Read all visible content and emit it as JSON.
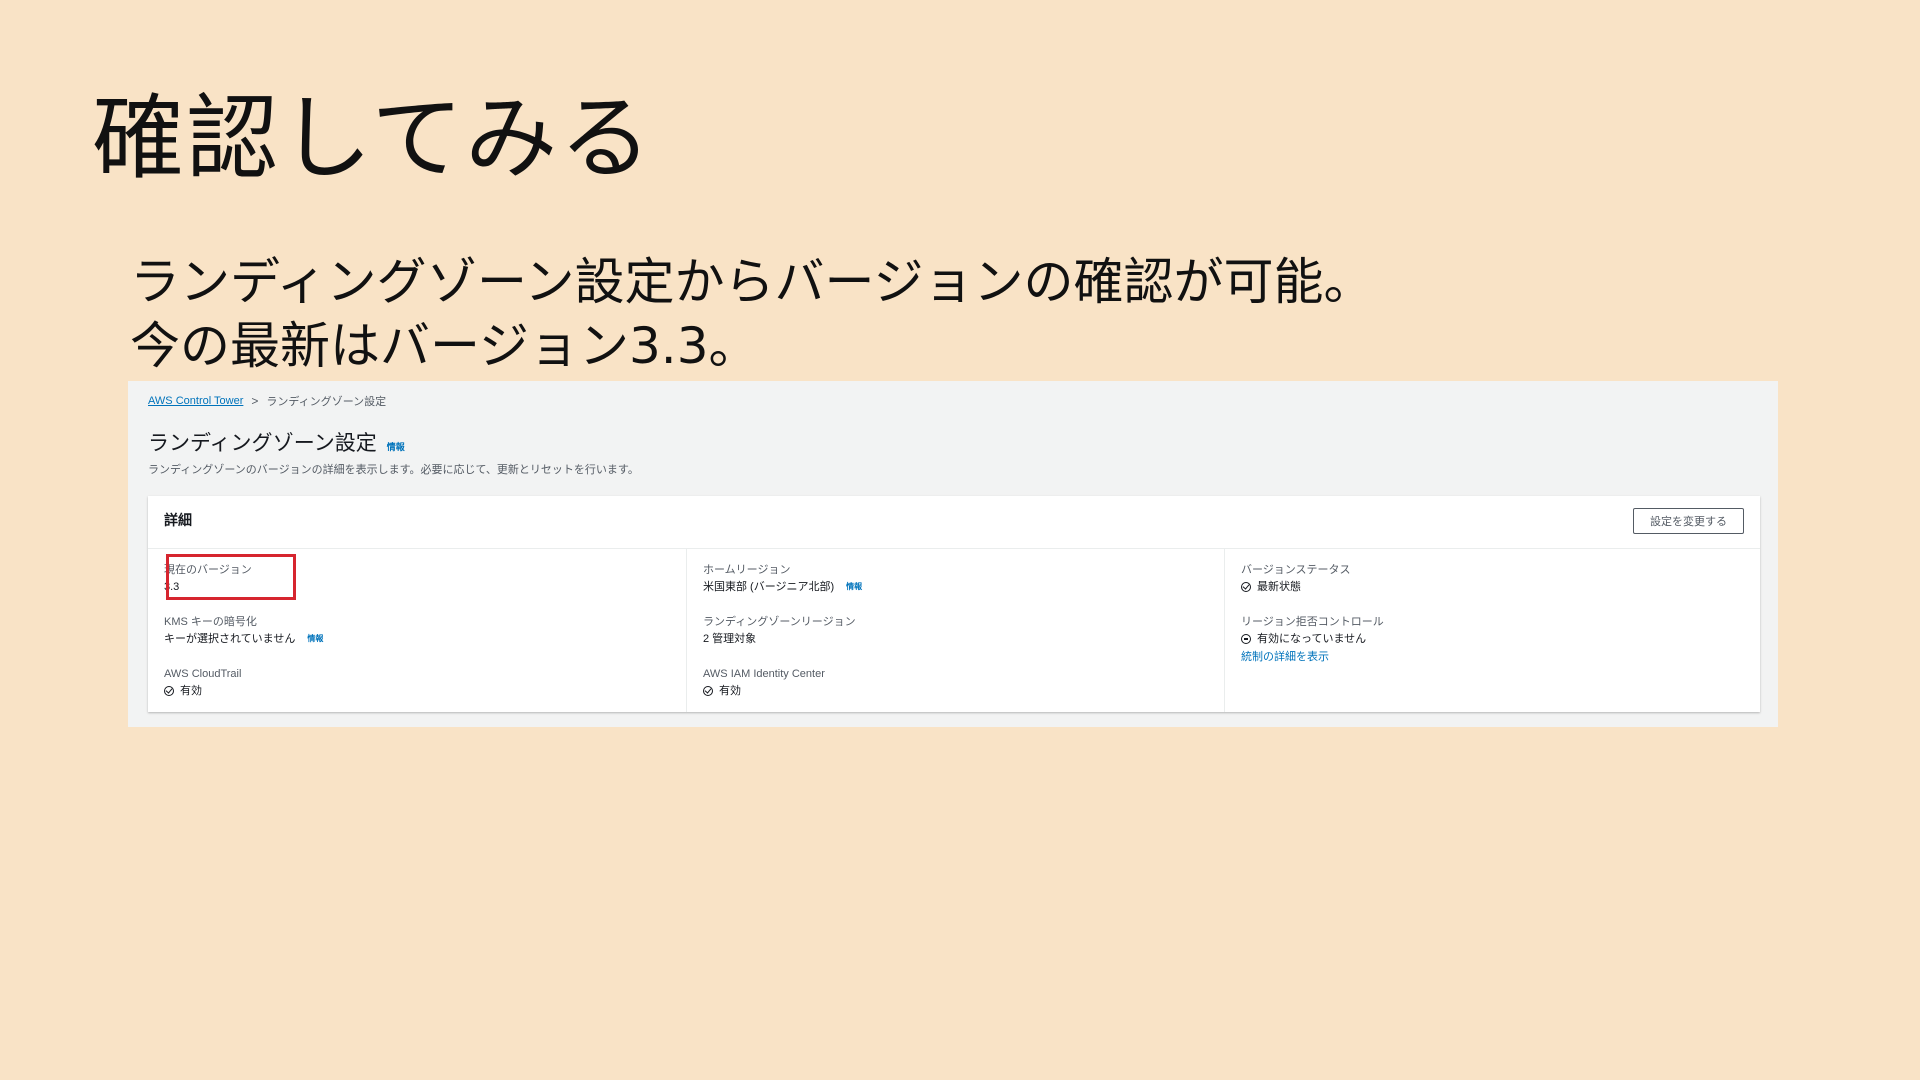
{
  "slide": {
    "title": "確認してみる",
    "body_line1": "ランディングゾーン設定からバージョンの確認が可能。",
    "body_line2": "今の最新はバージョン3.3。"
  },
  "console": {
    "breadcrumb": {
      "root": "AWS Control Tower",
      "separator": ">",
      "current": "ランディングゾーン設定"
    },
    "page_title": "ランディングゾーン設定",
    "info_label": "情報",
    "page_description": "ランディングゾーンのバージョンの詳細を表示します。必要に応じて、更新とリセットを行います。",
    "details": {
      "header": "詳細",
      "edit_button": "設定を変更する",
      "col1": {
        "current_version_label": "現在のバージョン",
        "current_version_value": "3.3",
        "kms_label": "KMS キーの暗号化",
        "kms_value": "キーが選択されていません",
        "cloudtrail_label": "AWS CloudTrail",
        "cloudtrail_value": "有効"
      },
      "col2": {
        "home_region_label": "ホームリージョン",
        "home_region_value": "米国東部 (バージニア北部)",
        "lz_region_label": "ランディングゾーンリージョン",
        "lz_region_value": "2 管理対象",
        "iam_label": "AWS IAM Identity Center",
        "iam_value": "有効"
      },
      "col3": {
        "version_status_label": "バージョンステータス",
        "version_status_value": "最新状態",
        "region_deny_label": "リージョン拒否コントロール",
        "region_deny_value": "有効になっていません",
        "control_details_link": "統制の詳細を表示"
      }
    },
    "colors": {
      "link": "#0073bb",
      "success": "#1d8102",
      "highlight": "#d6252f"
    }
  }
}
